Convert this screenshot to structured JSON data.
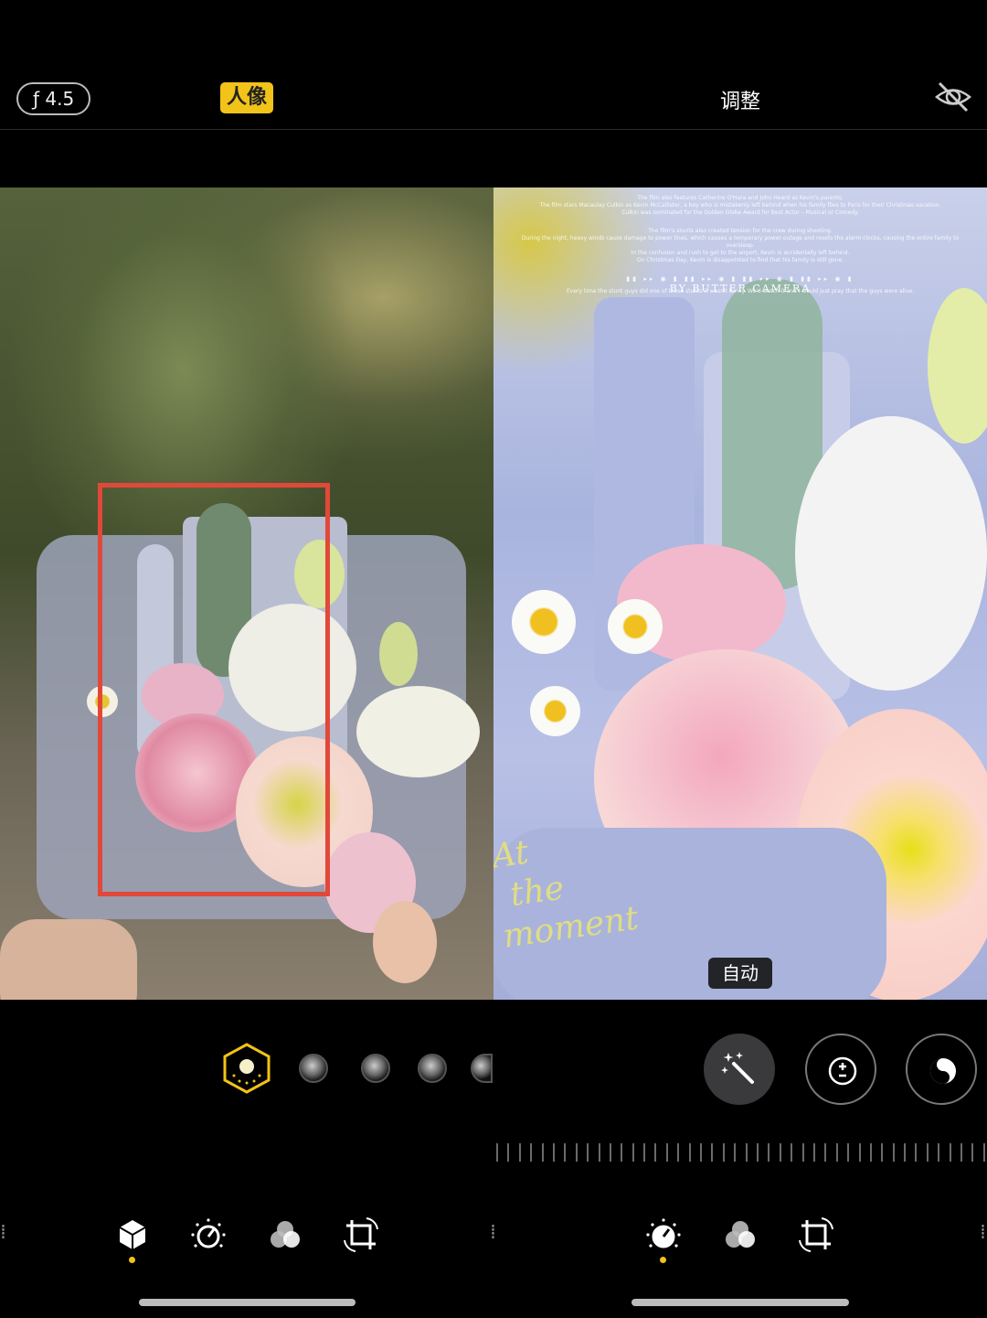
{
  "header": {
    "aperture_label": "ƒ 4.5",
    "portrait_label": "人像",
    "adjust_title": "调整",
    "hide_icon": "eye-slash-icon"
  },
  "right_photo": {
    "poster_lines": [
      "The film also features Catherine O'Hara and John Heard as Kevin's parents.",
      "The film stars Macaulay Culkin as Kevin McCallister, a boy who is mistakenly left behind when his family flies to Paris for their Christmas vacation.",
      "Culkin was nominated for the Golden Globe Award for Best Actor – Musical or Comedy.",
      "The film's stunts also created tension for the crew during shooting.",
      "During the night, heavy winds cause damage to power lines, which causes a temporary power outage and resets the alarm clocks, causing the entire family to oversleep.",
      "In the confusion and rush to get to the airport, Kevin is accidentally left behind.",
      "On Christmas Day, Kevin is disappointed to find that his family is still gone.",
      "Every time the stunt guys did one of those stunts it wasn't funny. We'd watch it and I would just pray that the guys were alive."
    ],
    "brand": "BY BUTTER CAMERA",
    "script_line1": "At",
    "script_line2": "the",
    "script_line3": "moment",
    "auto_label": "自动"
  },
  "lighting_icons": [
    "portrait-light-cube-icon",
    "light-option-icon",
    "light-option-icon",
    "light-option-icon",
    "light-option-icon"
  ],
  "tools": {
    "auto_enhance": "magic-wand-icon",
    "exposure": "exposure-icon",
    "black_white": "yin-yang-icon"
  },
  "bottom_tabs_left": [
    "portrait-cube-icon",
    "adjust-dial-icon",
    "filters-icon",
    "crop-icon"
  ],
  "bottom_tabs_right": [
    "adjust-dial-icon",
    "filters-icon",
    "crop-icon"
  ],
  "colors": {
    "accent": "#f2c318",
    "frame_red": "#e2483a"
  }
}
